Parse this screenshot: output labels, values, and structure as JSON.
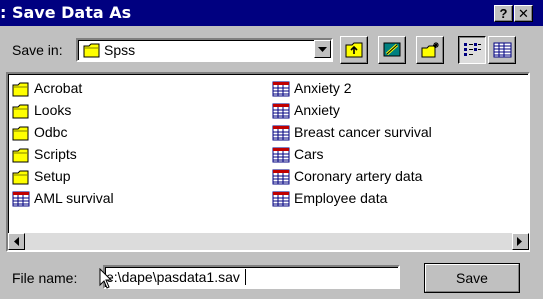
{
  "window": {
    "title": ": Save Data As",
    "help_button": "?",
    "close_button": "✕"
  },
  "toolbar": {
    "save_in_label": "Save in:",
    "save_in_value": "Spss"
  },
  "files": {
    "column1": [
      {
        "name": "Acrobat",
        "icon": "folder-icon"
      },
      {
        "name": "Looks",
        "icon": "folder-icon"
      },
      {
        "name": "Odbc",
        "icon": "folder-icon"
      },
      {
        "name": "Scripts",
        "icon": "folder-icon"
      },
      {
        "name": "Setup",
        "icon": "folder-icon"
      },
      {
        "name": "AML survival",
        "icon": "data-file-icon"
      }
    ],
    "column2": [
      {
        "name": "Anxiety 2",
        "icon": "data-file-icon"
      },
      {
        "name": "Anxiety",
        "icon": "data-file-icon"
      },
      {
        "name": "Breast cancer survival",
        "icon": "data-file-icon"
      },
      {
        "name": "Cars",
        "icon": "data-file-icon"
      },
      {
        "name": "Coronary artery data",
        "icon": "data-file-icon"
      },
      {
        "name": "Employee data",
        "icon": "data-file-icon"
      }
    ]
  },
  "filename": {
    "label": "File name:",
    "value": "e:\\dape\\pasdata1.sav"
  },
  "buttons": {
    "save_label": "Save"
  },
  "colors": {
    "titlebar": "#000080",
    "face": "#c0c0c0",
    "folder": "#ffff00"
  }
}
